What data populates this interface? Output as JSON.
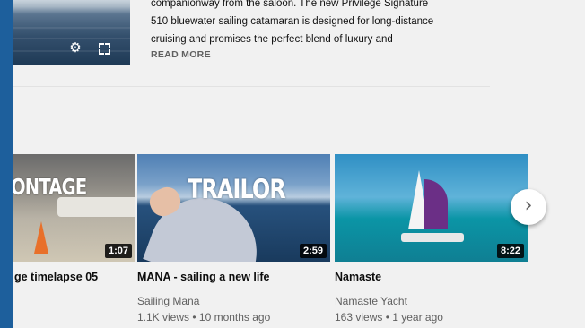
{
  "description": {
    "lines": [
      "companionway from the saloon. The new Privilege Signature",
      "510 bluewater sailing catamaran is designed for long-distance",
      "cruising and promises the perfect blend of luxury and"
    ],
    "read_more": "READ MORE"
  },
  "player": {
    "settings_icon": "gear-icon",
    "fullscreen_icon": "fullscreen-icon"
  },
  "shelf": {
    "videos": [
      {
        "overlay": "ONTAGE",
        "title": "ge timelapse 05",
        "channel": "",
        "meta": "",
        "duration": "1:07"
      },
      {
        "overlay": "TRAILOR",
        "title": "MANA - sailing a new life",
        "channel": "Sailing Mana",
        "meta": "1.1K views • 10 months ago",
        "duration": "2:59"
      },
      {
        "overlay": "",
        "title": "Namaste",
        "channel": "Namaste Yacht",
        "meta": "163 views • 1 year ago",
        "duration": "8:22"
      }
    ],
    "next_glyph": "›"
  },
  "colors": {
    "left_bar": "#1d5f9c",
    "background": "#f1f1f1"
  }
}
